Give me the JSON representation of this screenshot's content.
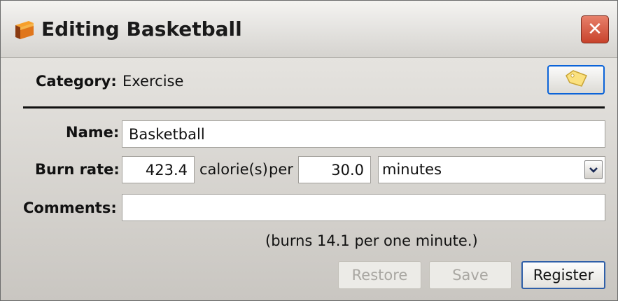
{
  "window": {
    "title": "Editing Basketball",
    "icon": "app-folder-icon",
    "close_icon": "close-icon"
  },
  "category": {
    "label": "Category:",
    "value": "Exercise",
    "tag_icon": "tag-icon"
  },
  "form": {
    "name_label": "Name:",
    "name_value": "Basketball",
    "burn_label": "Burn rate:",
    "burn_value": "423.4",
    "calories_text": "calorie(s)",
    "per_text": "per",
    "amount_value": "30.0",
    "unit_value": "minutes",
    "comments_label": "Comments:",
    "comments_value": ""
  },
  "info_text": "(burns 14.1 per one minute.)",
  "buttons": {
    "restore": "Restore",
    "save": "Save",
    "register": "Register"
  },
  "colors": {
    "focus_border": "#0b63d8",
    "close_red": "#d1462f"
  }
}
